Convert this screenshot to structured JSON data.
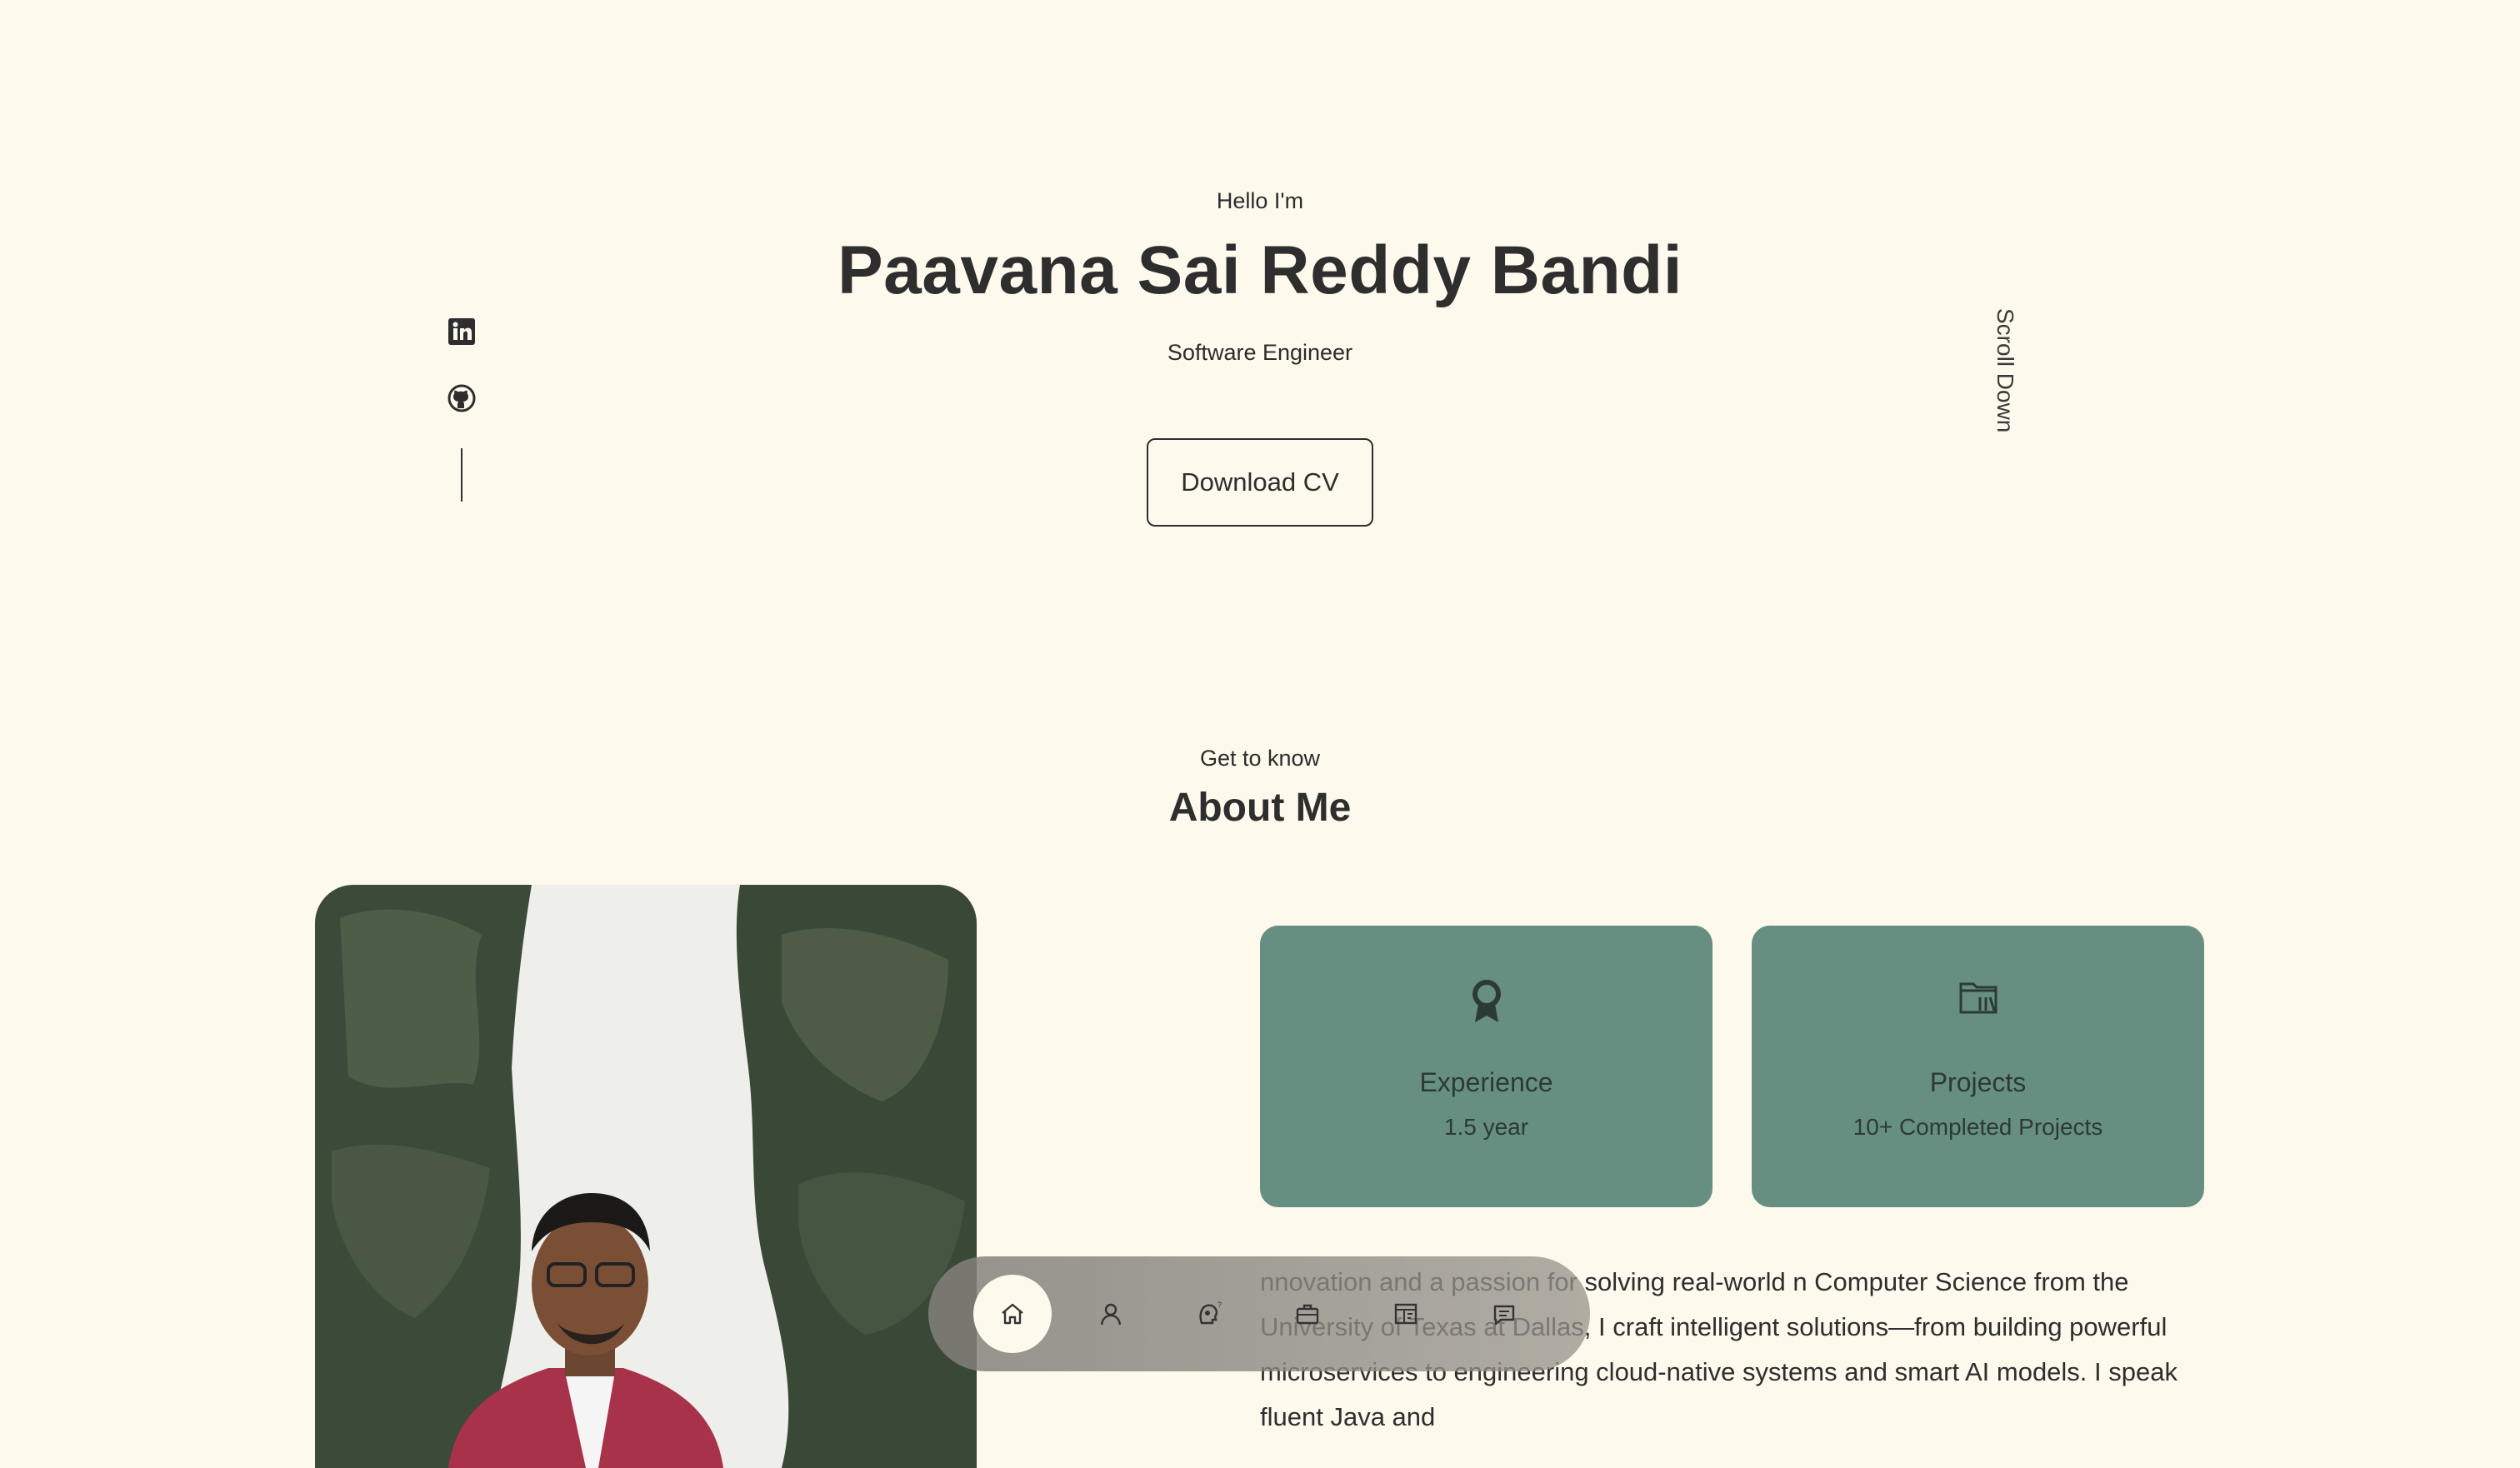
{
  "hero": {
    "greeting": "Hello I'm",
    "name": "Paavana Sai Reddy Bandi",
    "role": "Software Engineer",
    "cv_button": "Download CV",
    "scroll_label": "Scroll Down"
  },
  "social": {
    "icons": [
      "linkedin-icon",
      "github-icon"
    ]
  },
  "about": {
    "subtitle": "Get to know",
    "title": "About Me",
    "cards": [
      {
        "icon": "award-icon",
        "title": "Experience",
        "value": "1.5 year"
      },
      {
        "icon": "folder-icon",
        "title": "Projects",
        "value": "10+ Completed Projects"
      }
    ],
    "description": "nnovation and a passion for solving real-world n Computer Science from the University of Texas at Dallas, I craft intelligent solutions—from building powerful microservices to engineering cloud-native systems and smart AI models. I speak fluent Java and"
  },
  "nav": {
    "items": [
      "home-icon",
      "user-icon",
      "skills-icon",
      "briefcase-icon",
      "projects-icon",
      "message-icon"
    ],
    "active": "home-icon"
  },
  "colors": {
    "background": "#fdf9ec",
    "card": "#668f81",
    "text": "#2e2e2e"
  }
}
